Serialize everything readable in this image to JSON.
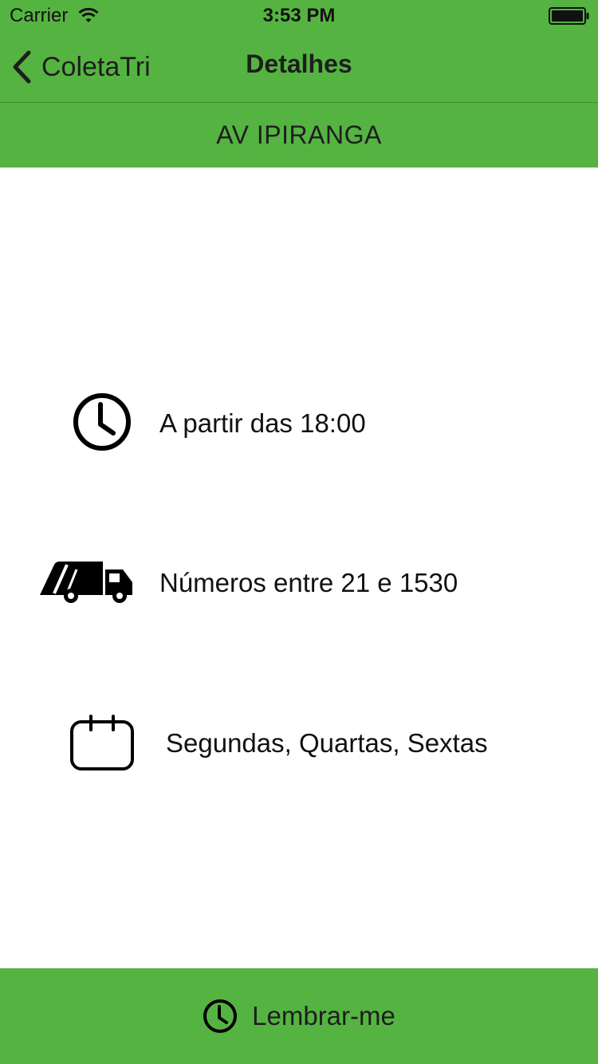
{
  "status_bar": {
    "carrier": "Carrier",
    "time": "3:53 PM"
  },
  "nav": {
    "back_label": "ColetaTri",
    "title": "Detalhes"
  },
  "street": {
    "name": "AV IPIRANGA"
  },
  "details": {
    "schedule": "A partir das 18:00",
    "numbers": "Números entre 21 e 1530",
    "days": "Segundas, Quartas, Sextas"
  },
  "actions": {
    "remind_label": "Lembrar-me"
  },
  "icons": {
    "wifi": "wifi-icon",
    "battery": "battery-icon",
    "back": "chevron-left-icon",
    "schedule": "clock-icon",
    "numbers": "garbage-truck-icon",
    "days": "calendar-icon",
    "remind": "clock-icon"
  },
  "colors": {
    "brand_green": "#55b441",
    "text_dark": "#1e1e1e"
  }
}
